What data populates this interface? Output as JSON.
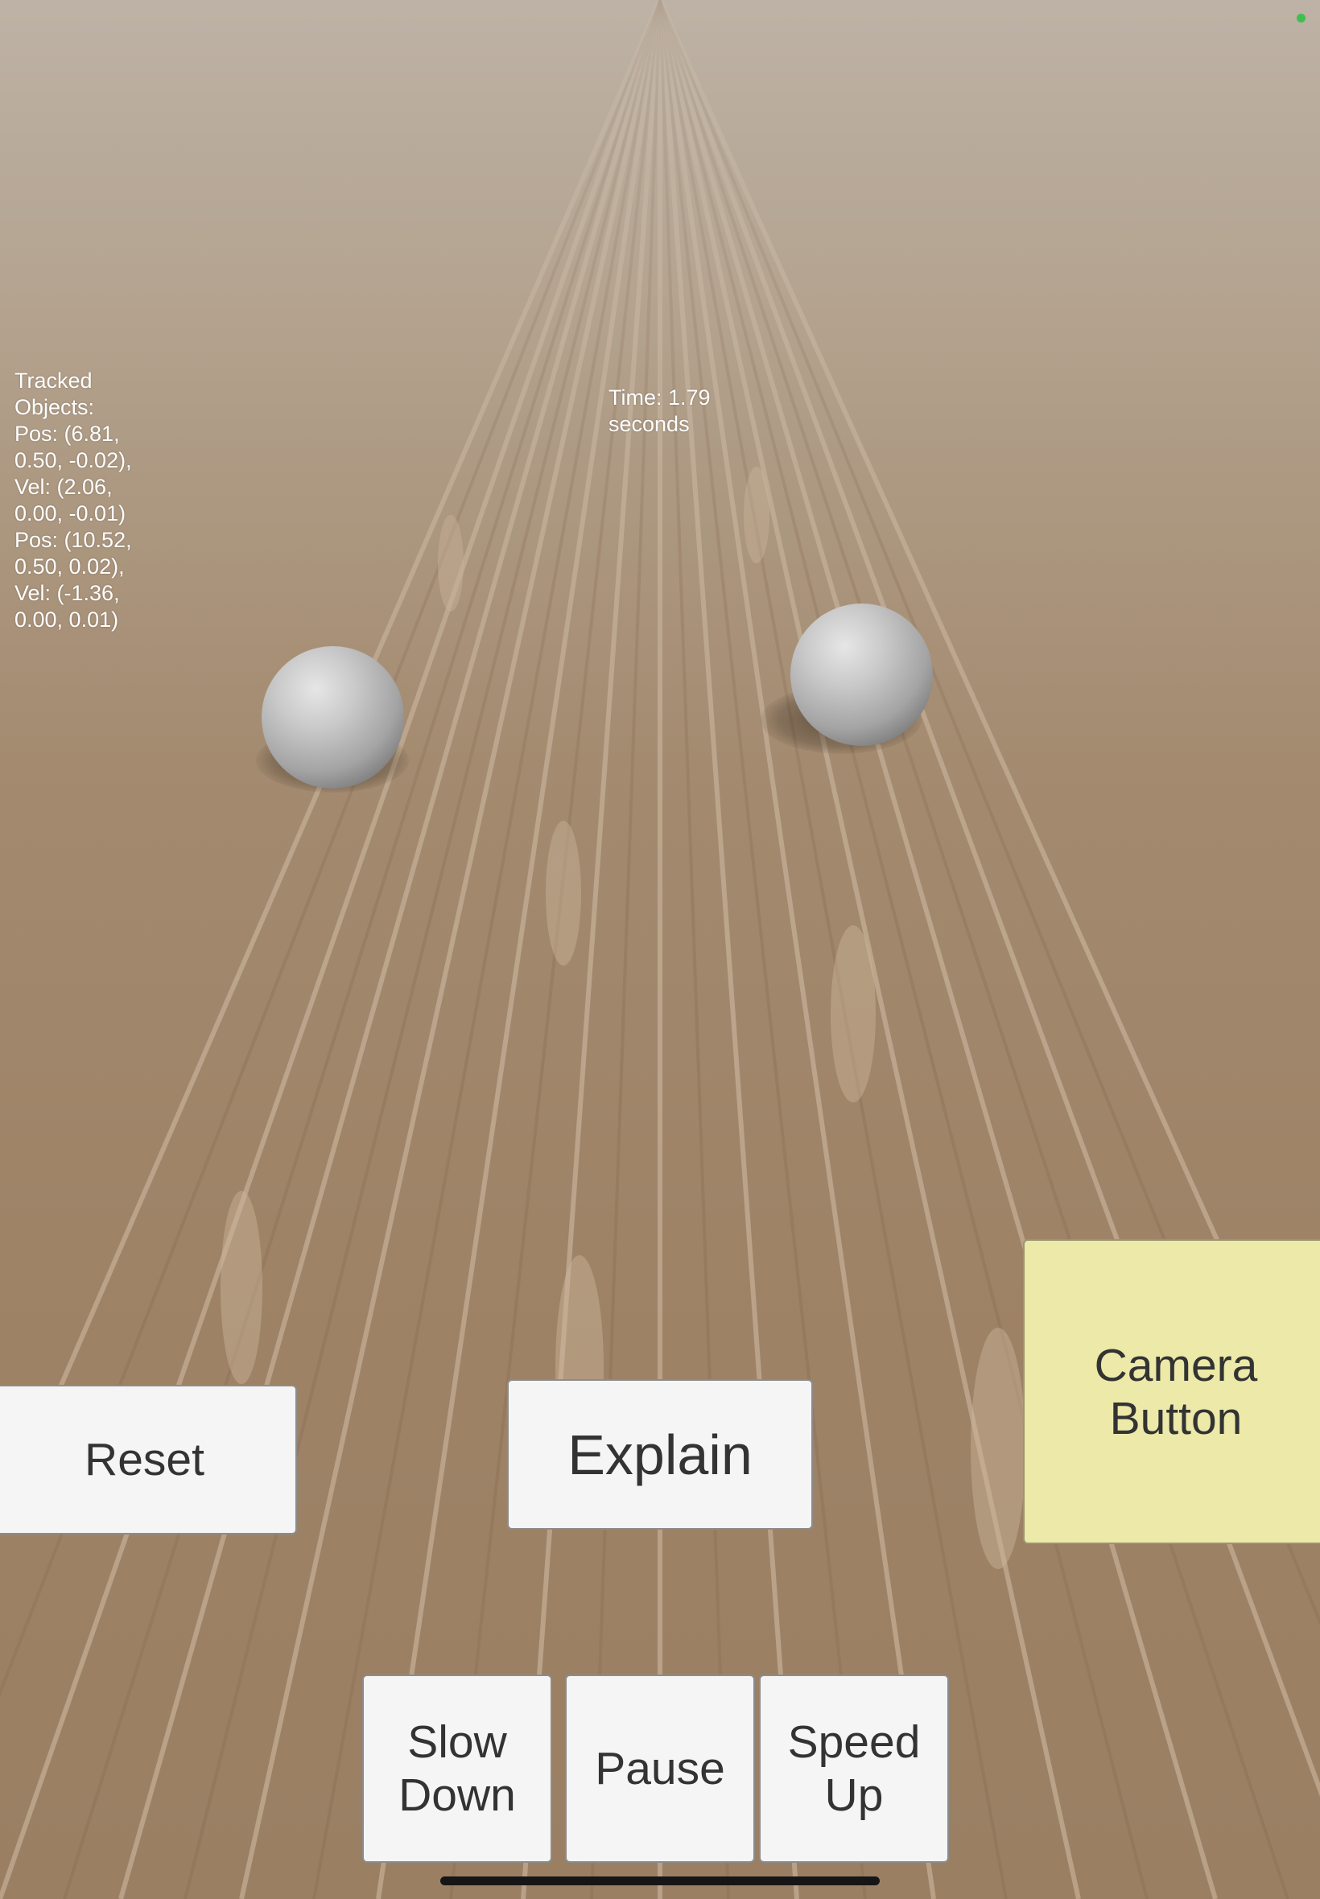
{
  "hud": {
    "tracked_lines": [
      "Tracked",
      "Objects:",
      "Pos: (6.81,",
      "0.50, -0.02),",
      "Vel: (2.06,",
      "0.00, -0.01)",
      "Pos: (10.52,",
      "0.50, 0.02),",
      "Vel: (-1.36,",
      "0.00, 0.01)"
    ],
    "time_line1": "Time: 1.79",
    "time_line2": "seconds"
  },
  "buttons": {
    "reset": "Reset",
    "explain": "Explain",
    "camera_line1": "Camera",
    "camera_line2": "Button",
    "slow_line1": "Slow",
    "slow_line2": "Down",
    "pause": "Pause",
    "speed_line1": "Speed",
    "speed_line2": "Up"
  },
  "colors": {
    "camera_button": "#ece9a9",
    "button": "#f5f5f6",
    "button_text": "#333333",
    "hud_text": "#ffffff",
    "status_dot": "#3fbf4f"
  }
}
